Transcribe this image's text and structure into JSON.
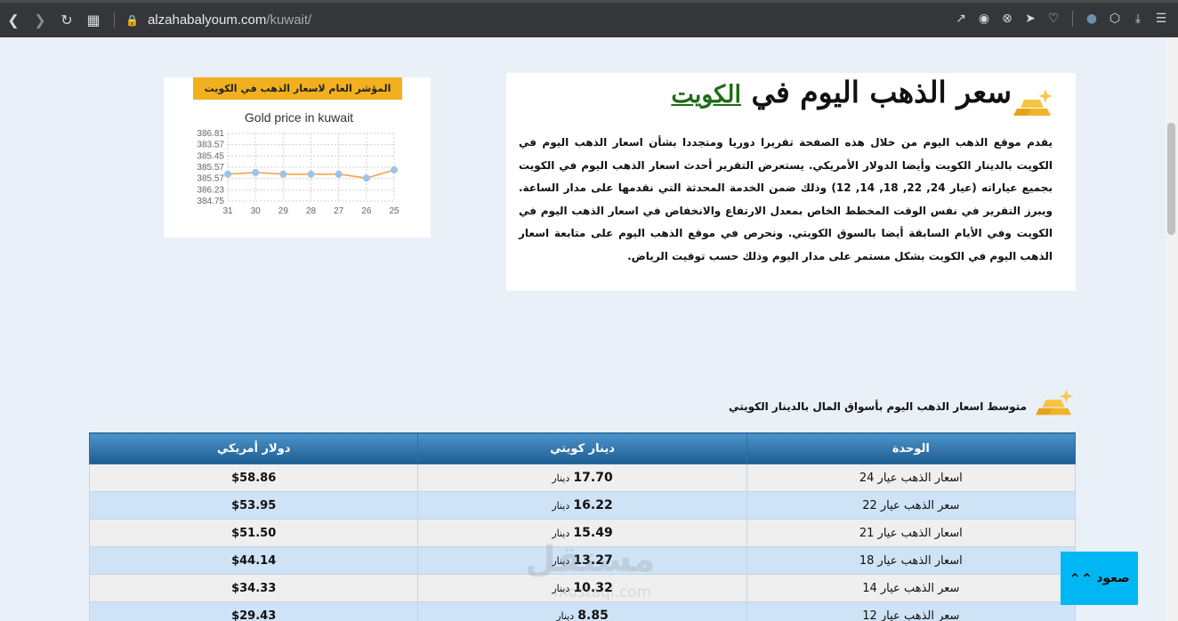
{
  "browser": {
    "url_host": "alzahabalyoum.com",
    "url_path": "/kuwait/",
    "icons_left": [
      "back-icon",
      "forward-icon",
      "reload-icon",
      "tabs-grid-icon",
      "lock-icon"
    ],
    "icons_right": [
      "share-icon",
      "camera-icon",
      "shield-icon",
      "send-icon",
      "heart-icon",
      "extension-icon",
      "cube-icon",
      "download-icon",
      "menu-icon"
    ]
  },
  "chart_card": {
    "header": "المؤشر العام لاسعار الذهب في الكويت"
  },
  "chart_data": {
    "type": "line",
    "title": "Gold price in kuwait",
    "categories": [
      "31",
      "30",
      "29",
      "28",
      "27",
      "26",
      "25"
    ],
    "series": [
      {
        "values": [
          385.57,
          385.62,
          385.57,
          385.57,
          385.57,
          385.45,
          385.7
        ]
      }
    ],
    "ylim": [
      384.75,
      386.81
    ],
    "yticks": [
      "386.81",
      "383.57",
      "385.45",
      "385.57",
      "385.57",
      "386.23",
      "384.75"
    ],
    "grid": true,
    "line_color": "#f2a03d",
    "marker_color": "#9cc3ea"
  },
  "intro": {
    "title_prefix": "سعر الذهب اليوم في",
    "title_link": "الكويت",
    "body": "يقدم موقع الذهب اليوم من خلال هذه الصفحة تقريرا دوريا ومتجددا بشأن اسعار الذهب اليوم في الكويت بالدينار الكويت وأيضا الدولار الأمريكي. يستعرض التقرير أحدث اسعار الذهب اليوم في الكويت بجميع عياراته (عيار 24, 22, 18, 14, 12) وذلك ضمن الخدمة المحدثة التي نقدمها على مدار الساعة. ويبرز التقرير في نفس الوقت المخطط الخاص بمعدل الارتفاع والانخفاض في اسعار الذهب اليوم في الكويت وفي الأيام السابقة أيضا بالسوق الكويتي. ونحرص في موقع الذهب اليوم على متابعة اسعار الذهب اليوم في الكويت بشكل مستمر على مدار اليوم وذلك حسب توقيت الرياض."
  },
  "section": {
    "title": "متوسط اسعار الذهب اليوم بأسواق المال بالدينار الكويتي"
  },
  "table": {
    "headers": {
      "unit": "الوحدة",
      "kwd": "دينار كويتي",
      "usd": "دولار أمريكي"
    },
    "currency_word": "دينار",
    "rows": [
      {
        "unit": "اسعار الذهب عيار 24",
        "kwd": "17.70",
        "usd": "$58.86"
      },
      {
        "unit": "سعر الذهب عيار 22",
        "kwd": "16.22",
        "usd": "$53.95"
      },
      {
        "unit": "اسعار الذهب عيار 21",
        "kwd": "15.49",
        "usd": "$51.50"
      },
      {
        "unit": "اسعار الذهب عيار 18",
        "kwd": "13.27",
        "usd": "$44.14"
      },
      {
        "unit": "سعر الذهب عيار 14",
        "kwd": "10.32",
        "usd": "$34.33"
      },
      {
        "unit": "سعر الذهب عيار 12",
        "kwd": "8.85",
        "usd": "$29.43"
      }
    ]
  },
  "watermark": {
    "arabic": "مستقل",
    "latin": "mostaql.com"
  },
  "back_to_top": {
    "label": "صعود",
    "icon": "double-chevron-up-icon"
  }
}
